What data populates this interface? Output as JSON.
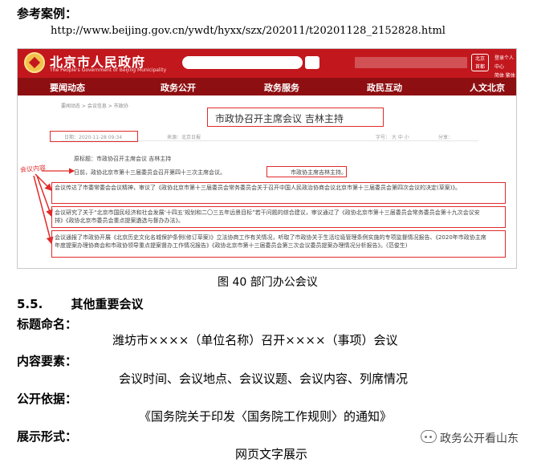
{
  "reference": {
    "heading": "参考案例：",
    "url": "http://www.beijing.gov.cn/ywdt/hyxx/szx/202011/t20201128_2152828.html"
  },
  "screenshot": {
    "site_title": "北京市人民政府",
    "site_subtitle": "The People's Government of Beijing Municipality",
    "badge_text": "北京\n首都",
    "right_links": [
      "登录个人中心",
      "简体 繁体"
    ],
    "nav": [
      "要闻动态",
      "政务公开",
      "政务服务",
      "政民互动",
      "人文北京"
    ],
    "breadcrumb": "要闻动态  >  会议信息  >  市政协",
    "article_title": "市政协召开主席会议 吉林主持",
    "meta_date": "日期：2020-11-28 09:34",
    "meta_source": "来源：北京日报",
    "meta_font": "字号：  大  中  小",
    "meta_share": "分享：",
    "side_label": "会议内容",
    "paragraphs": [
      "原标题：市政协召开主席会议 吉林主持",
      "日前，政协北京市第十三届委员会召开第四十三次主席会议。",
      "市政协主席吉林主持。",
      "会议传达了市委常委会会议精神，审议了《政协北京市第十三届委员会常务委员会关于召开中国人民政治协商会议北京市第十三届委员会第四次会议的决定(草案)》。",
      "会议研究了关于“北京市国民经济和社会发展‘十四五’规划和二〇三五年远景目标”若干问题的综合建议，审议通过了《政协北京市第十三届委员会常务委员会第十九次会议安排》《政协北京市委员会重点提案遴选与督办办法》。",
      "会议通报了市政协开展《北京历史文化名城保护条例(修订草案)》立法协商工作有关情况，听取了市政协关于生活垃圾管理条例实施的专项监督情况报告、《2020年市政协主席年度提案办理协商会和市政协领导重点提案督办工作情况报告》《政协北京市第十三届委员会第三次会议委员提案办理情况分析报告》。(范俊生)"
    ]
  },
  "figure_caption": "图 40 部门办公会议",
  "section": {
    "number": "5.5.",
    "title": "其他重要会议",
    "items": [
      {
        "label": "标题命名：",
        "value": "潍坊市××××（单位名称）召开××××（事项）会议"
      },
      {
        "label": "内容要素：",
        "value": "会议时间、会议地点、会议议题、会议内容、列席情况"
      },
      {
        "label": "公开依据：",
        "value": "《国务院关于印发〈国务院工作规则〉的通知》"
      },
      {
        "label": "展示形式：",
        "value": "网页文字展示"
      }
    ]
  },
  "watermark": "政务公开看山东",
  "colors": {
    "gov_red": "#c2171d",
    "nav_red": "#8e0f12",
    "annotation_red": "#e02b2b"
  }
}
